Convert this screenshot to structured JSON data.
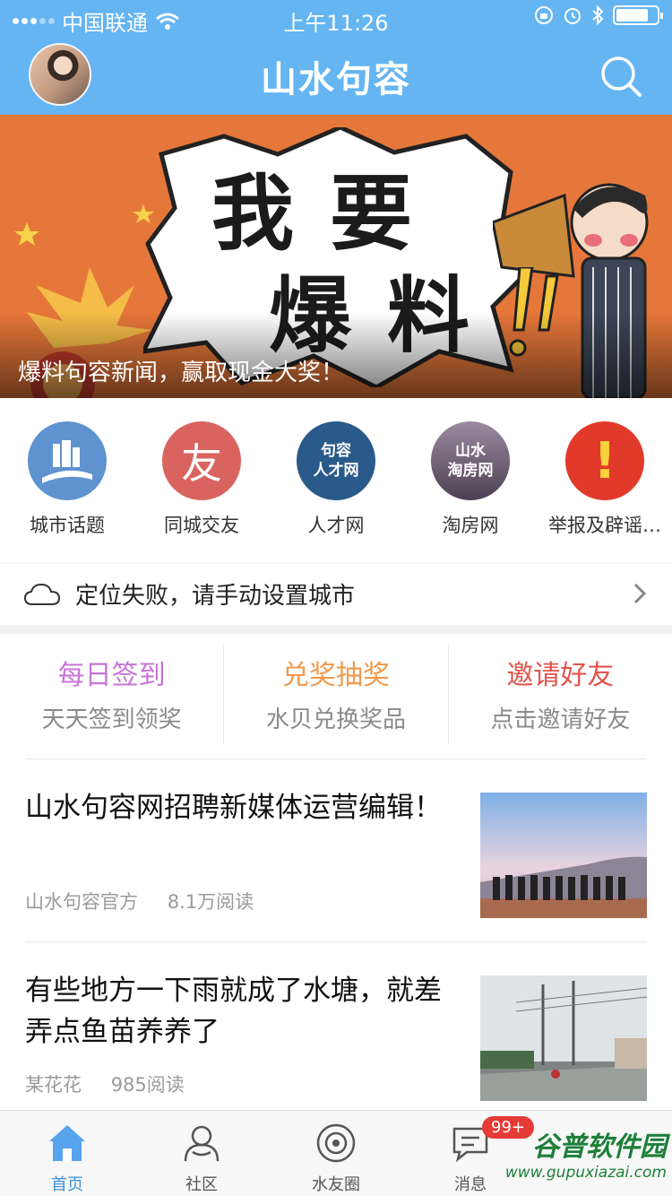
{
  "status_bar": {
    "carrier": "中国联通",
    "time": "上午11:26",
    "battery_level": 0.8
  },
  "header": {
    "title": "山水句容",
    "avatar_icon": "user-avatar",
    "search_icon": "search-icon"
  },
  "banner": {
    "headline_line1": "我要",
    "headline_line2": "爆料",
    "caption": "爆料句容新闻，赢取现金大奖！"
  },
  "quick_links": [
    {
      "label": "城市话题",
      "icon": "city-road-icon",
      "color": "#5f93cf",
      "glyph": ""
    },
    {
      "label": "同城交友",
      "icon": "friend-icon",
      "color": "#d9645f",
      "glyph": "友"
    },
    {
      "label": "人才网",
      "icon": "talent-network-icon",
      "color": "#2a5a8a",
      "glyph": "句容\n人才网"
    },
    {
      "label": "淘房网",
      "icon": "house-network-icon",
      "color": "#6d5a70",
      "glyph": "山水\n淘房网"
    },
    {
      "label": "举报及辟谣…",
      "icon": "report-alert-icon",
      "color": "#e23a2a",
      "glyph": "!"
    }
  ],
  "location": {
    "text": "定位失败，请手动设置城市",
    "icon": "cloud-icon"
  },
  "promos": [
    {
      "title": "每日签到",
      "subtitle": "天天签到领奖",
      "color": "#c774d6"
    },
    {
      "title": "兑奖抽奖",
      "subtitle": "水贝兑换奖品",
      "color": "#f2984a"
    },
    {
      "title": "邀请好友",
      "subtitle": "点击邀请好友",
      "color": "#e2534c"
    }
  ],
  "news": [
    {
      "title": "山水句容网招聘新媒体运营编辑！",
      "author": "山水句容官方",
      "reads": "8.1万阅读"
    },
    {
      "title": "有些地方一下雨就成了水塘，就差弄点鱼苗养养了",
      "author": "某花花",
      "reads": "985阅读"
    }
  ],
  "tabs": [
    {
      "label": "首页",
      "icon": "home-icon",
      "active": true
    },
    {
      "label": "社区",
      "icon": "community-icon",
      "active": false
    },
    {
      "label": "水友圈",
      "icon": "circle-icon",
      "active": false
    },
    {
      "label": "消息",
      "icon": "message-icon",
      "active": false,
      "badge": "99+"
    }
  ],
  "watermark": {
    "name": "谷普软件园",
    "url": "www.gupuxiazai.com"
  },
  "colors": {
    "header": "#64b5f2",
    "banner": "#e6773a",
    "tab_active": "#3d8fd9"
  }
}
